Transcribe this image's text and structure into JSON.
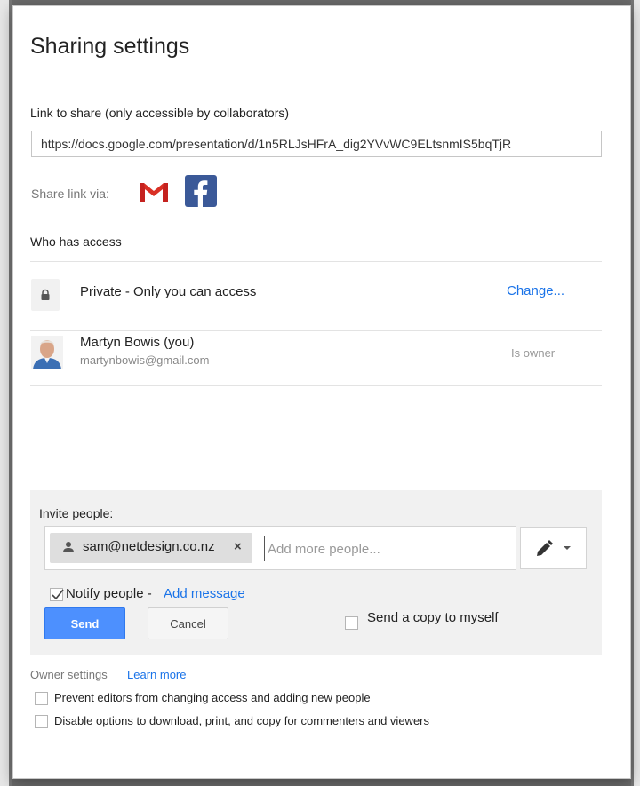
{
  "dialog": {
    "title": "Sharing settings"
  },
  "link": {
    "label": "Link to share (only accessible by collaborators)",
    "url": "https://docs.google.com/presentation/d/1n5RLJsHFrA_dig2YVvWC9ELtsnmIS5bqTjR"
  },
  "share_via": {
    "label": "Share link via:",
    "services": [
      "gmail-icon",
      "facebook-icon"
    ]
  },
  "access": {
    "heading": "Who has access",
    "visibility": {
      "icon": "lock-icon",
      "text": "Private - Only you can access",
      "change_label": "Change..."
    },
    "users": [
      {
        "name": "Martyn Bowis (you)",
        "email": "martynbowis@gmail.com",
        "role": "Is owner"
      }
    ]
  },
  "invite": {
    "label": "Invite people:",
    "chips": [
      {
        "email": "sam@netdesign.co.nz",
        "remove": "×"
      }
    ],
    "placeholder": "Add more people...",
    "permission_icon": "pencil-icon",
    "notify": {
      "checked": true,
      "label": "Notify people -",
      "add_message": "Add message"
    },
    "send_label": "Send",
    "cancel_label": "Cancel",
    "copy": {
      "checked": false,
      "label": "Send a copy to myself"
    }
  },
  "owner_settings": {
    "label": "Owner settings",
    "learn_more": "Learn more",
    "options": [
      {
        "checked": false,
        "label": "Prevent editors from changing access and adding new people"
      },
      {
        "checked": false,
        "label": "Disable options to download, print, and copy for commenters and viewers"
      }
    ]
  },
  "colors": {
    "link_blue": "#1a73e8",
    "send_blue": "#4d90fe",
    "facebook": "#3b5998",
    "gmail_red": "#d93025"
  }
}
